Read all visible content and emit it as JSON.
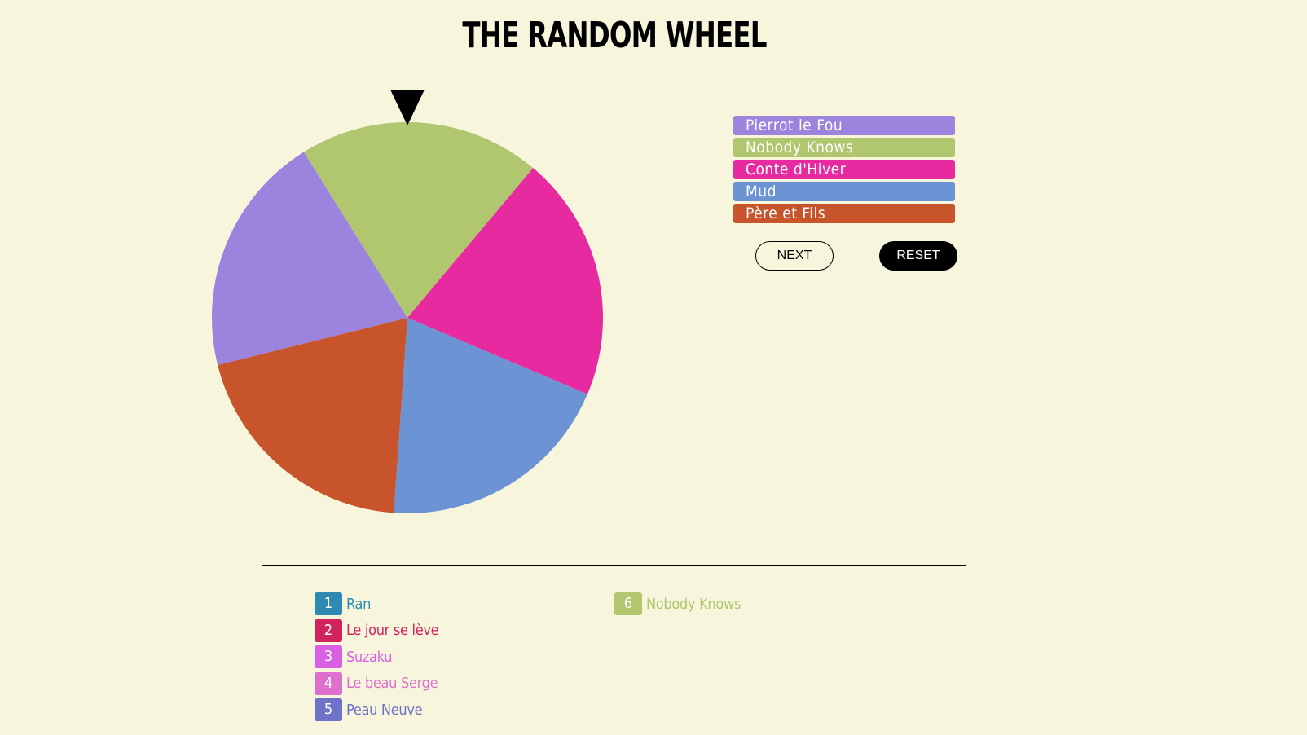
{
  "app": {
    "title": "THE RANDOM WHEEL"
  },
  "wheel": {
    "pointer_icon": "triangle-down-icon",
    "segments": [
      {
        "label": "Nobody Knows",
        "color": "#b1c76f",
        "start_deg": -32,
        "end_deg": 40
      },
      {
        "label": "Conte d'Hiver",
        "color": "#e72a9f",
        "start_deg": 40,
        "end_deg": 113
      },
      {
        "label": "Mud",
        "color": "#6c93d4",
        "start_deg": 113,
        "end_deg": 184
      },
      {
        "label": "Père et Fils",
        "color": "#c8542c",
        "start_deg": 184,
        "end_deg": 256
      },
      {
        "label": "Pierrot le Fou",
        "color": "#9b83de",
        "start_deg": 256,
        "end_deg": 328
      }
    ]
  },
  "movie_list": [
    {
      "label": "Pierrot le Fou",
      "color": "#9b83de"
    },
    {
      "label": "Nobody Knows",
      "color": "#b1c76f"
    },
    {
      "label": "Conte d'Hiver",
      "color": "#e72a9f"
    },
    {
      "label": "Mud",
      "color": "#6c93d4"
    },
    {
      "label": "Père et Fils",
      "color": "#c8542c"
    }
  ],
  "buttons": {
    "next": "NEXT",
    "reset": "RESET"
  },
  "results": {
    "column1": [
      {
        "num": "1",
        "name": "Ran",
        "color": "#2e8ab3"
      },
      {
        "num": "2",
        "name": "Le jour se lève",
        "color": "#d1245f"
      },
      {
        "num": "3",
        "name": "Suzaku",
        "color": "#d95fe3"
      },
      {
        "num": "4",
        "name": "Le beau Serge",
        "color": "#de6fcf"
      },
      {
        "num": "5",
        "name": "Peau Neuve",
        "color": "#6f72c9"
      }
    ],
    "column2": [
      {
        "num": "6",
        "name": "Nobody Knows",
        "color": "#b1c76f"
      }
    ]
  }
}
